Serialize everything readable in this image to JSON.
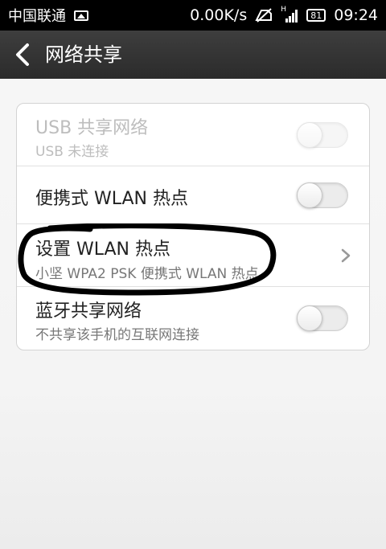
{
  "status_bar": {
    "carrier": "中国联通",
    "speed": "0.00K/s",
    "network_type": "H",
    "battery": "81",
    "time": "09:24"
  },
  "header": {
    "title": "网络共享"
  },
  "rows": [
    {
      "title": "USB 共享网络",
      "subtitle": "USB 未连接",
      "control": "toggle",
      "on": false,
      "enabled": false
    },
    {
      "title": "便携式 WLAN 热点",
      "control": "toggle",
      "on": false,
      "enabled": true
    },
    {
      "title": "设置 WLAN 热点",
      "subtitle": "小坚 WPA2 PSK 便携式 WLAN 热点",
      "control": "chevron",
      "enabled": true
    },
    {
      "title": "蓝牙共享网络",
      "subtitle": "不共享该手机的互联网连接",
      "control": "toggle",
      "on": false,
      "enabled": true
    }
  ],
  "colors": {
    "title_bar": "#333333",
    "status_bar": "#000000",
    "annotation": "#000000"
  }
}
